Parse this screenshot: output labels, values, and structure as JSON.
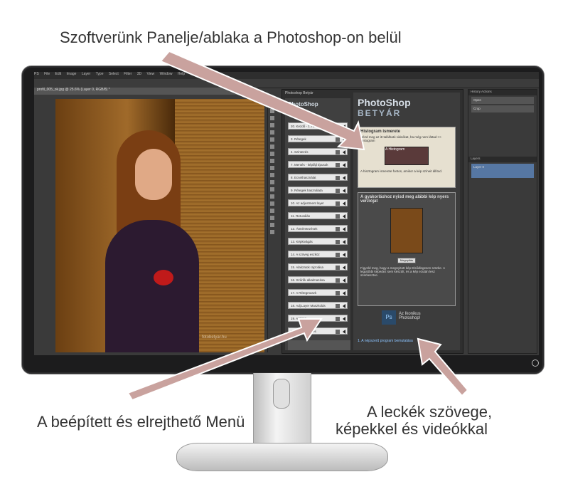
{
  "captions": {
    "top": "Szoftverünk Panelje/ablaka a Photoshop-on belül",
    "menu": "A beépített és elrejthető Menü",
    "text_line1": "A leckék szövege,",
    "text_line2": "képekkel és videókkal"
  },
  "colors": {
    "arrow": "#c9a29e",
    "arrow_outline": "#ffffff"
  },
  "photoshop": {
    "menubar": [
      "PS",
      "File",
      "Edit",
      "Image",
      "Layer",
      "Type",
      "Select",
      "Filter",
      "3D",
      "View",
      "Window",
      "Help"
    ],
    "doc_tab": "profil_005_ok.jpg @ 25.6% (Layer 0, RGB/8) *",
    "watermark": "fotobetyar.hu"
  },
  "plugin": {
    "panel_title": "Photoshop Betyár",
    "logo_small": "PhotoShop",
    "logo_main": "PhotoShop",
    "logo_sub": "BETYÁR",
    "menu_items": [
      "20. Kezdő - 1. rész",
      "3. Rétegek",
      "4. Szintezés",
      "7. Mentés - képfájl típusok",
      "8. Ecsethasználat",
      "9. Rétegek használata",
      "10. Az adjustment layer",
      "11. Retusálás",
      "12. Átméretezések",
      "13. Képkivágás",
      "14. A szöveg eszköz",
      "15. Alakzatok rajzolása",
      "16. Szűrők alkalmazása",
      "17. A Rétegmaszk",
      "18. Adj.Layer Maszkolás",
      "19. Actions",
      "20. Hajszín festés"
    ],
    "box1_title": "Histogram ismerete",
    "box1_text": "Nézd meg az itt található videókat, ha még nem láttad >> Histogram",
    "box1_thumb": "A Histogram",
    "box1_caption": "A hisztogram ismerete fontos, amikor a kép színeit állítod.",
    "box2_title": "A gyakorláshoz nyisd meg alábbi kép nyers verzióját",
    "box2_button": "Megnyitás",
    "box2_bullets": "Figyeld meg, hogy a megnyitott kép Elsődlegesen szürke. A legutóbbi képedez sem készült, és a kép ezután lesz szerkesztve.",
    "ps_icon": "Ps",
    "ps_text": "Az Ikonikus Photoshop!",
    "footer_link": "1. A népszerű program bemutatása"
  },
  "right_panel": {
    "tabs": "History  Actions",
    "layers_tab": "Layers",
    "layer_items": [
      "Open",
      "Crop"
    ],
    "layer_selected": "Layer 0"
  }
}
